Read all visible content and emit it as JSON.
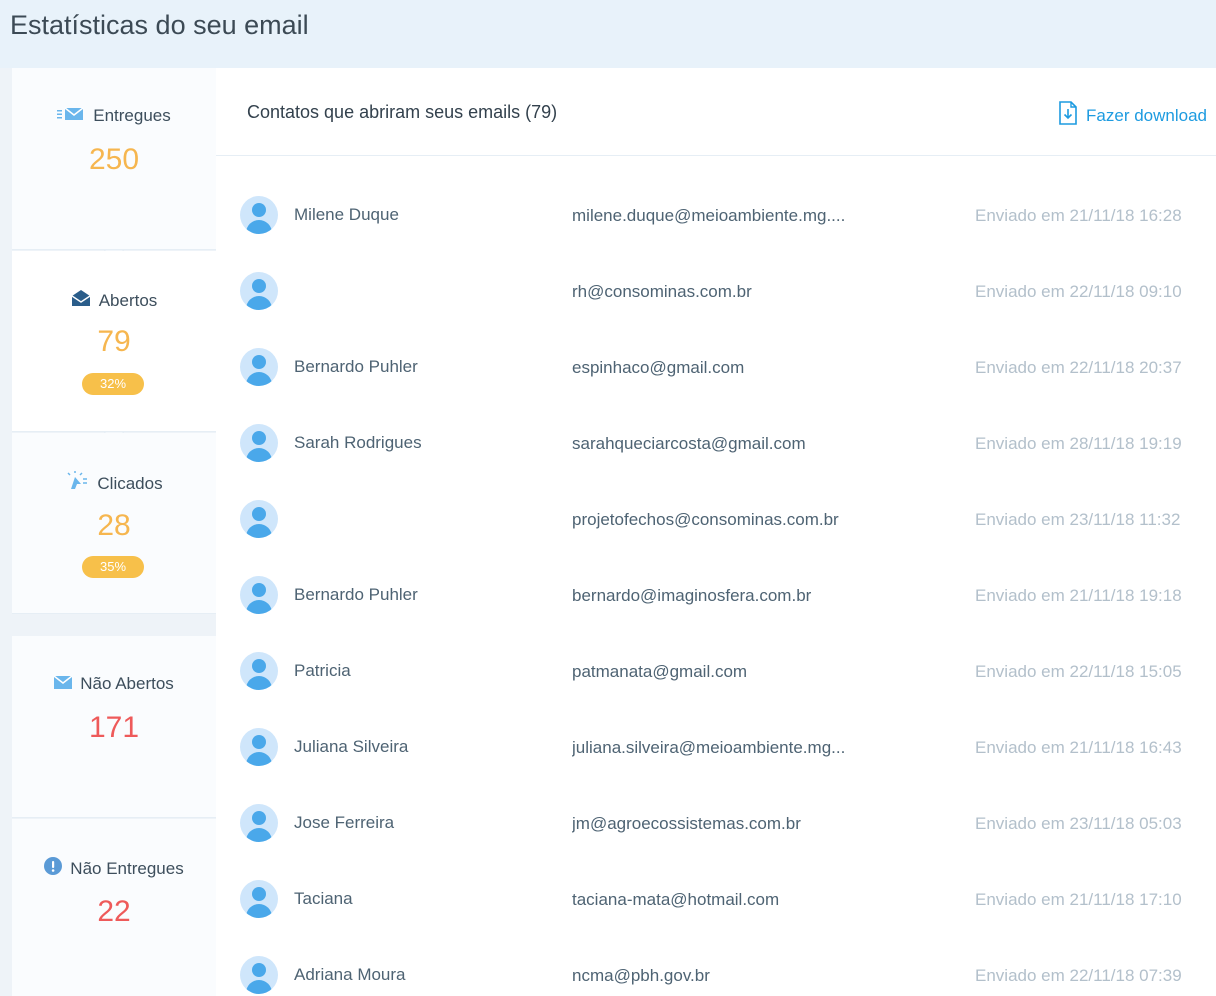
{
  "header": {
    "title": "Estatísticas do seu email"
  },
  "sidebar": {
    "delivered": {
      "label": "Entregues",
      "value": "250"
    },
    "opened": {
      "label": "Abertos",
      "value": "79",
      "percent": "32%"
    },
    "clicked": {
      "label": "Clicados",
      "value": "28",
      "percent": "35%"
    },
    "not_opened": {
      "label": "Não Abertos",
      "value": "171"
    },
    "not_delivered": {
      "label": "Não Entregues",
      "value": "22"
    }
  },
  "main": {
    "title": "Contatos que abriram seus emails (79)",
    "download_label": "Fazer download",
    "contacts": [
      {
        "name": "Milene Duque",
        "email": "milene.duque@meioambiente.mg....",
        "sent": "Enviado em 21/11/18 16:28"
      },
      {
        "name": "",
        "email": "rh@consominas.com.br",
        "sent": "Enviado em 22/11/18 09:10"
      },
      {
        "name": "Bernardo Puhler",
        "email": "espinhaco@gmail.com",
        "sent": "Enviado em 22/11/18 20:37"
      },
      {
        "name": "Sarah Rodrigues",
        "email": "sarahqueciarcosta@gmail.com",
        "sent": "Enviado em 28/11/18 19:19"
      },
      {
        "name": "",
        "email": "projetofechos@consominas.com.br",
        "sent": "Enviado em 23/11/18 11:32"
      },
      {
        "name": "Bernardo Puhler",
        "email": "bernardo@imaginosfera.com.br",
        "sent": "Enviado em 21/11/18 19:18"
      },
      {
        "name": "Patricia",
        "email": "patmanata@gmail.com",
        "sent": "Enviado em 22/11/18 15:05"
      },
      {
        "name": "Juliana Silveira",
        "email": "juliana.silveira@meioambiente.mg...",
        "sent": "Enviado em 21/11/18 16:43"
      },
      {
        "name": "Jose Ferreira",
        "email": "jm@agroecossistemas.com.br",
        "sent": "Enviado em 23/11/18 05:03"
      },
      {
        "name": "Taciana",
        "email": "taciana-mata@hotmail.com",
        "sent": "Enviado em 21/11/18 17:10"
      },
      {
        "name": "Adriana Moura",
        "email": "ncma@pbh.gov.br",
        "sent": "Enviado em 22/11/18 07:39"
      }
    ]
  },
  "colors": {
    "accent": "#1d9be0",
    "orange": "#f6b64f",
    "red": "#ee5a5a",
    "pill": "#f7c04a"
  }
}
